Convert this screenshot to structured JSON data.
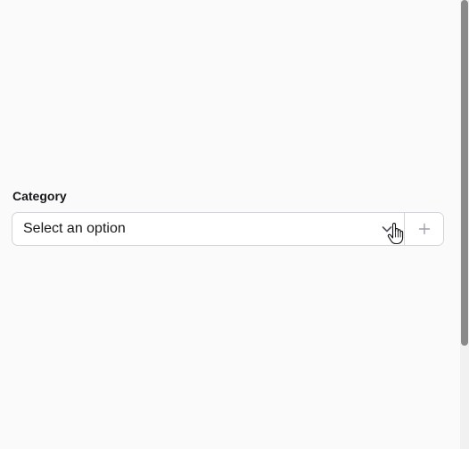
{
  "field": {
    "label": "Category",
    "select": {
      "placeholder": "Select an option",
      "chevron_icon": "chevron-down-icon"
    },
    "add_button": {
      "icon": "plus-icon"
    }
  },
  "pointer": {
    "icon": "hand-pointer-icon"
  },
  "colors": {
    "background": "#fafafa",
    "border": "#d4d4d8",
    "text": "#18181b",
    "muted_icon": "#a1a1aa",
    "scrollbar_thumb": "#8a8a8a"
  }
}
